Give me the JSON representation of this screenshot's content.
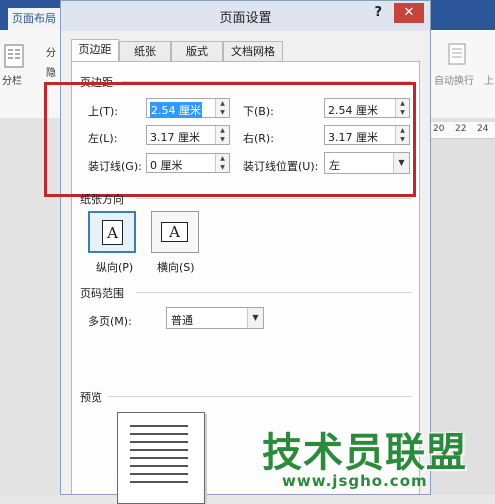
{
  "background": {
    "ribbon_tab": "页面布局",
    "left_items": [
      "分栏",
      "分",
      "隐"
    ],
    "auto_wrap": "自动换行",
    "up_label": "上",
    "ruler_ticks": [
      "20",
      "22",
      "24"
    ]
  },
  "dialog": {
    "title": "页面设置",
    "help": "?",
    "close": "✕",
    "tabs": [
      "页边距",
      "纸张",
      "版式",
      "文档网格"
    ],
    "margins": {
      "section_title": "页边距",
      "top": {
        "label": "上(T):",
        "value": "2.54 厘米"
      },
      "bottom": {
        "label": "下(B):",
        "value": "2.54 厘米"
      },
      "left": {
        "label": "左(L):",
        "value": "3.17 厘米"
      },
      "right": {
        "label": "右(R):",
        "value": "3.17 厘米"
      },
      "gutter": {
        "label": "装订线(G):",
        "value": "0 厘米"
      },
      "gutter_position": {
        "label": "装订线位置(U):",
        "value": "左"
      }
    },
    "orientation": {
      "section_title": "纸张方向",
      "portrait": "纵向(P)",
      "landscape": "横向(S)",
      "glyph": "A",
      "selected": "portrait"
    },
    "pages": {
      "section_title": "页码范围",
      "multiple_label": "多页(M):",
      "multiple_value": "普通"
    },
    "preview": {
      "section_title": "预览"
    }
  },
  "watermark": {
    "text": "技术员联盟",
    "url": "www.jsgho.com"
  },
  "colors": {
    "highlight_box": "#c0272d",
    "selection": "#3399ff",
    "watermark": "#2c8a3c"
  }
}
